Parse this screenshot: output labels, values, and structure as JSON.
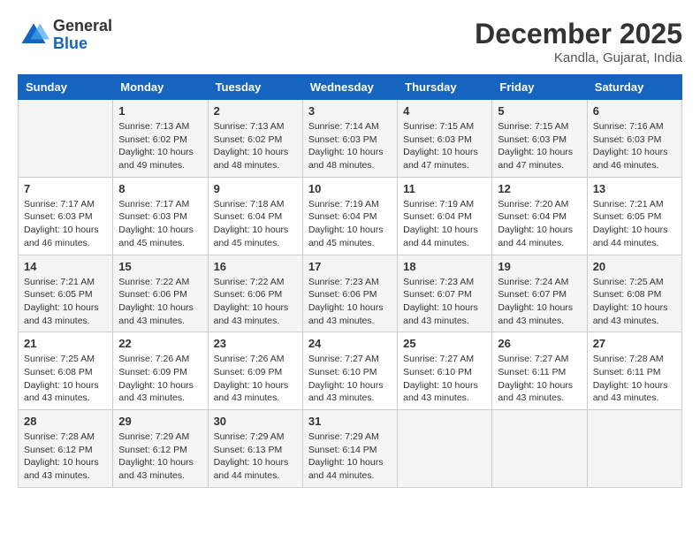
{
  "header": {
    "logo_general": "General",
    "logo_blue": "Blue",
    "month_title": "December 2025",
    "location": "Kandla, Gujarat, India"
  },
  "calendar": {
    "days_of_week": [
      "Sunday",
      "Monday",
      "Tuesday",
      "Wednesday",
      "Thursday",
      "Friday",
      "Saturday"
    ],
    "weeks": [
      [
        {
          "day": "",
          "info": ""
        },
        {
          "day": "1",
          "info": "Sunrise: 7:13 AM\nSunset: 6:02 PM\nDaylight: 10 hours\nand 49 minutes."
        },
        {
          "day": "2",
          "info": "Sunrise: 7:13 AM\nSunset: 6:02 PM\nDaylight: 10 hours\nand 48 minutes."
        },
        {
          "day": "3",
          "info": "Sunrise: 7:14 AM\nSunset: 6:03 PM\nDaylight: 10 hours\nand 48 minutes."
        },
        {
          "day": "4",
          "info": "Sunrise: 7:15 AM\nSunset: 6:03 PM\nDaylight: 10 hours\nand 47 minutes."
        },
        {
          "day": "5",
          "info": "Sunrise: 7:15 AM\nSunset: 6:03 PM\nDaylight: 10 hours\nand 47 minutes."
        },
        {
          "day": "6",
          "info": "Sunrise: 7:16 AM\nSunset: 6:03 PM\nDaylight: 10 hours\nand 46 minutes."
        }
      ],
      [
        {
          "day": "7",
          "info": "Sunrise: 7:17 AM\nSunset: 6:03 PM\nDaylight: 10 hours\nand 46 minutes."
        },
        {
          "day": "8",
          "info": "Sunrise: 7:17 AM\nSunset: 6:03 PM\nDaylight: 10 hours\nand 45 minutes."
        },
        {
          "day": "9",
          "info": "Sunrise: 7:18 AM\nSunset: 6:04 PM\nDaylight: 10 hours\nand 45 minutes."
        },
        {
          "day": "10",
          "info": "Sunrise: 7:19 AM\nSunset: 6:04 PM\nDaylight: 10 hours\nand 45 minutes."
        },
        {
          "day": "11",
          "info": "Sunrise: 7:19 AM\nSunset: 6:04 PM\nDaylight: 10 hours\nand 44 minutes."
        },
        {
          "day": "12",
          "info": "Sunrise: 7:20 AM\nSunset: 6:04 PM\nDaylight: 10 hours\nand 44 minutes."
        },
        {
          "day": "13",
          "info": "Sunrise: 7:21 AM\nSunset: 6:05 PM\nDaylight: 10 hours\nand 44 minutes."
        }
      ],
      [
        {
          "day": "14",
          "info": "Sunrise: 7:21 AM\nSunset: 6:05 PM\nDaylight: 10 hours\nand 43 minutes."
        },
        {
          "day": "15",
          "info": "Sunrise: 7:22 AM\nSunset: 6:06 PM\nDaylight: 10 hours\nand 43 minutes."
        },
        {
          "day": "16",
          "info": "Sunrise: 7:22 AM\nSunset: 6:06 PM\nDaylight: 10 hours\nand 43 minutes."
        },
        {
          "day": "17",
          "info": "Sunrise: 7:23 AM\nSunset: 6:06 PM\nDaylight: 10 hours\nand 43 minutes."
        },
        {
          "day": "18",
          "info": "Sunrise: 7:23 AM\nSunset: 6:07 PM\nDaylight: 10 hours\nand 43 minutes."
        },
        {
          "day": "19",
          "info": "Sunrise: 7:24 AM\nSunset: 6:07 PM\nDaylight: 10 hours\nand 43 minutes."
        },
        {
          "day": "20",
          "info": "Sunrise: 7:25 AM\nSunset: 6:08 PM\nDaylight: 10 hours\nand 43 minutes."
        }
      ],
      [
        {
          "day": "21",
          "info": "Sunrise: 7:25 AM\nSunset: 6:08 PM\nDaylight: 10 hours\nand 43 minutes."
        },
        {
          "day": "22",
          "info": "Sunrise: 7:26 AM\nSunset: 6:09 PM\nDaylight: 10 hours\nand 43 minutes."
        },
        {
          "day": "23",
          "info": "Sunrise: 7:26 AM\nSunset: 6:09 PM\nDaylight: 10 hours\nand 43 minutes."
        },
        {
          "day": "24",
          "info": "Sunrise: 7:27 AM\nSunset: 6:10 PM\nDaylight: 10 hours\nand 43 minutes."
        },
        {
          "day": "25",
          "info": "Sunrise: 7:27 AM\nSunset: 6:10 PM\nDaylight: 10 hours\nand 43 minutes."
        },
        {
          "day": "26",
          "info": "Sunrise: 7:27 AM\nSunset: 6:11 PM\nDaylight: 10 hours\nand 43 minutes."
        },
        {
          "day": "27",
          "info": "Sunrise: 7:28 AM\nSunset: 6:11 PM\nDaylight: 10 hours\nand 43 minutes."
        }
      ],
      [
        {
          "day": "28",
          "info": "Sunrise: 7:28 AM\nSunset: 6:12 PM\nDaylight: 10 hours\nand 43 minutes."
        },
        {
          "day": "29",
          "info": "Sunrise: 7:29 AM\nSunset: 6:12 PM\nDaylight: 10 hours\nand 43 minutes."
        },
        {
          "day": "30",
          "info": "Sunrise: 7:29 AM\nSunset: 6:13 PM\nDaylight: 10 hours\nand 44 minutes."
        },
        {
          "day": "31",
          "info": "Sunrise: 7:29 AM\nSunset: 6:14 PM\nDaylight: 10 hours\nand 44 minutes."
        },
        {
          "day": "",
          "info": ""
        },
        {
          "day": "",
          "info": ""
        },
        {
          "day": "",
          "info": ""
        }
      ]
    ]
  }
}
